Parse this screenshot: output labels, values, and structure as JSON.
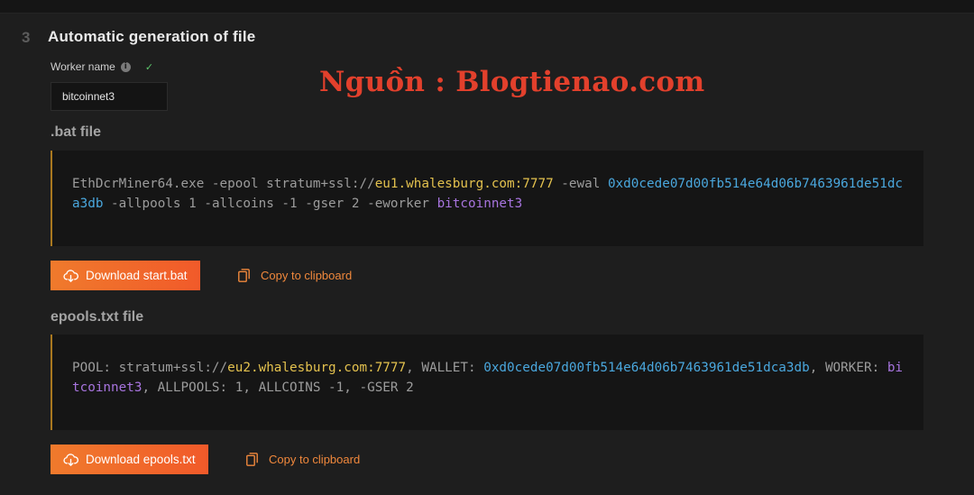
{
  "section": {
    "step_number": "3",
    "title": "Automatic generation of file"
  },
  "worker": {
    "label": "Worker name",
    "info_glyph": "i",
    "check_glyph": "✓",
    "value": "bitcoinnet3"
  },
  "watermark": "Nguồn : Blogtienao.com",
  "bat_file": {
    "title": ".bat file",
    "code": {
      "p1": "EthDcrMiner64.exe -epool stratum+ssl://",
      "host": "eu1.whalesburg.com:7777",
      "p2": " -ewal ",
      "wallet": "0xd0cede07d00fb514e64d06b7463961de51dca3db",
      "p3": " -allpools 1 -allcoins -1 -gser 2 -eworker ",
      "worker": "bitcoinnet3"
    },
    "download_label": "Download start.bat",
    "copy_label": "Copy to clipboard"
  },
  "epools_file": {
    "title": "epools.txt file",
    "code": {
      "p1": "POOL: stratum+ssl://",
      "host": "eu2.whalesburg.com:7777",
      "p2": ", WALLET: ",
      "wallet": "0xd0cede07d00fb514e64d06b7463961de51dca3db",
      "p3": ", WORKER: ",
      "worker": "bitcoinnet3",
      "p4": ", ALLPOOLS: 1, ALLCOINS -1, -GSER 2"
    },
    "download_label": "Download epools.txt",
    "copy_label": "Copy to clipboard"
  },
  "colors": {
    "accent": "#f15a2a",
    "host": "#e3c14e",
    "wallet": "#4aa7dd",
    "worker": "#a774de",
    "watermark": "#e2402c"
  },
  "icons": {
    "download": "cloud-download-icon",
    "copy": "copy-icon",
    "info": "info-icon",
    "check": "check-icon"
  }
}
